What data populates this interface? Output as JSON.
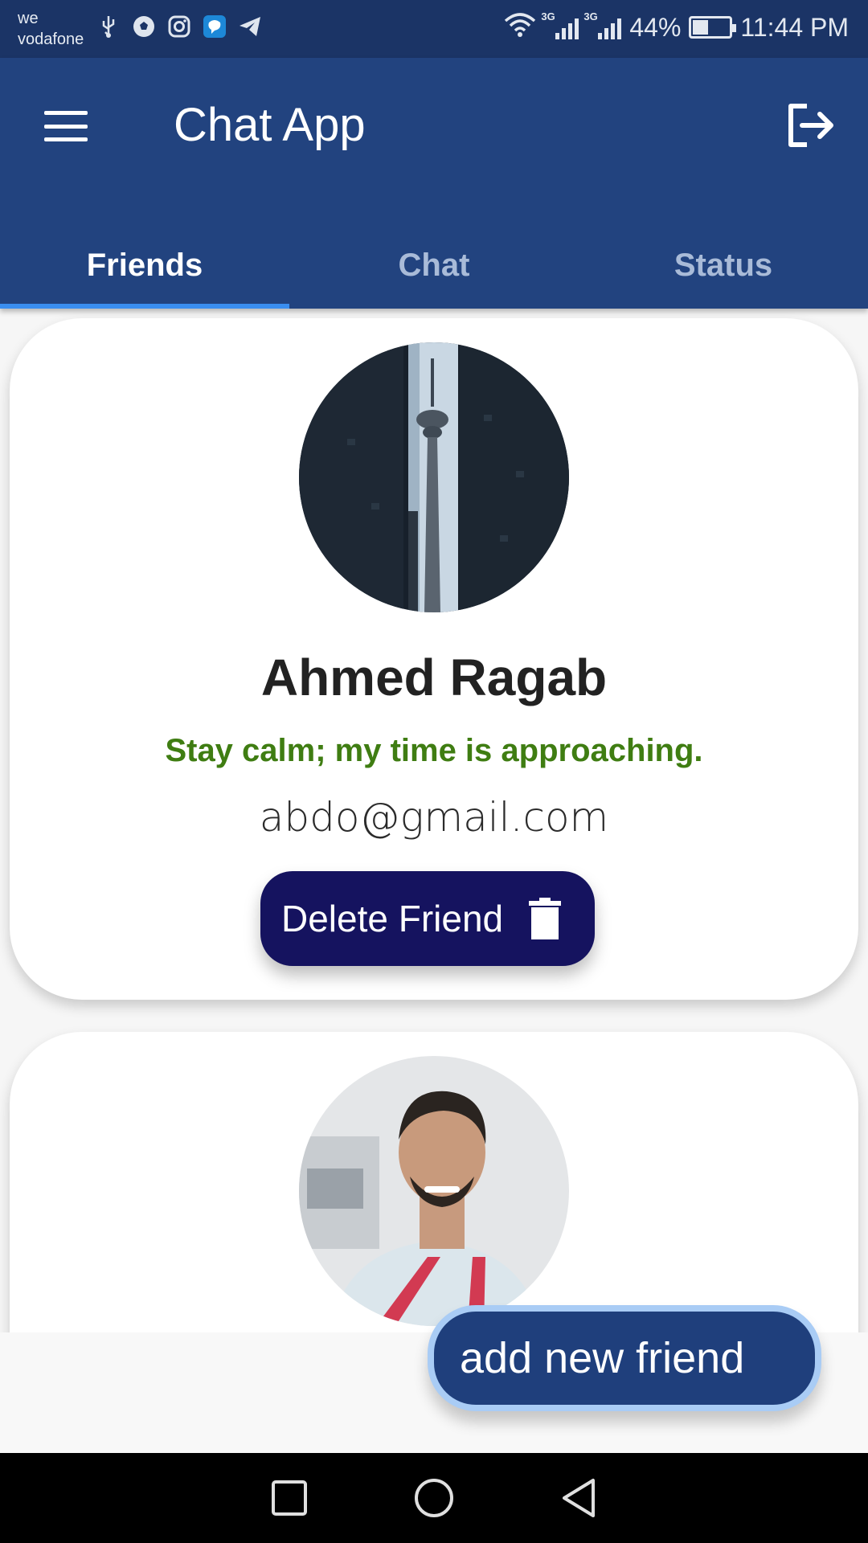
{
  "status_bar": {
    "carrier_line1": "we",
    "carrier_line2": "vodafone",
    "network1": "3G",
    "network2": "3G",
    "battery": "44%",
    "battery_level": 0.44,
    "time": "11:44 PM",
    "icons": [
      "usb-icon",
      "soccer-ball-icon",
      "instagram-icon",
      "messenger-icon",
      "telegram-icon",
      "wifi-icon"
    ]
  },
  "app_bar": {
    "title": "Chat App",
    "menu_icon": "hamburger-menu-icon",
    "logout_icon": "logout-icon"
  },
  "tabs": [
    {
      "label": "Friends",
      "active": true
    },
    {
      "label": "Chat",
      "active": false
    },
    {
      "label": "Status",
      "active": false
    }
  ],
  "friends": [
    {
      "name": "Ahmed Ragab",
      "status": "Stay calm; my time is approaching.",
      "email": "abdo@gmail.com",
      "delete_label": "Delete Friend",
      "avatar": "cn-tower-photo"
    },
    {
      "avatar": "man-selfie-photo"
    }
  ],
  "fab": {
    "label": "add new friend"
  },
  "colors": {
    "status_bar": "#1b3466",
    "app_bar": "#22437f",
    "tab_indicator": "#3a8ef0",
    "delete_button": "#15135f",
    "status_text": "#3f7d12",
    "fab": "#1f3f7c",
    "fab_border": "#a9ccf5"
  },
  "nav": {
    "recent_icon": "square-recent-apps-icon",
    "home_icon": "circle-home-icon",
    "back_icon": "triangle-back-icon"
  }
}
